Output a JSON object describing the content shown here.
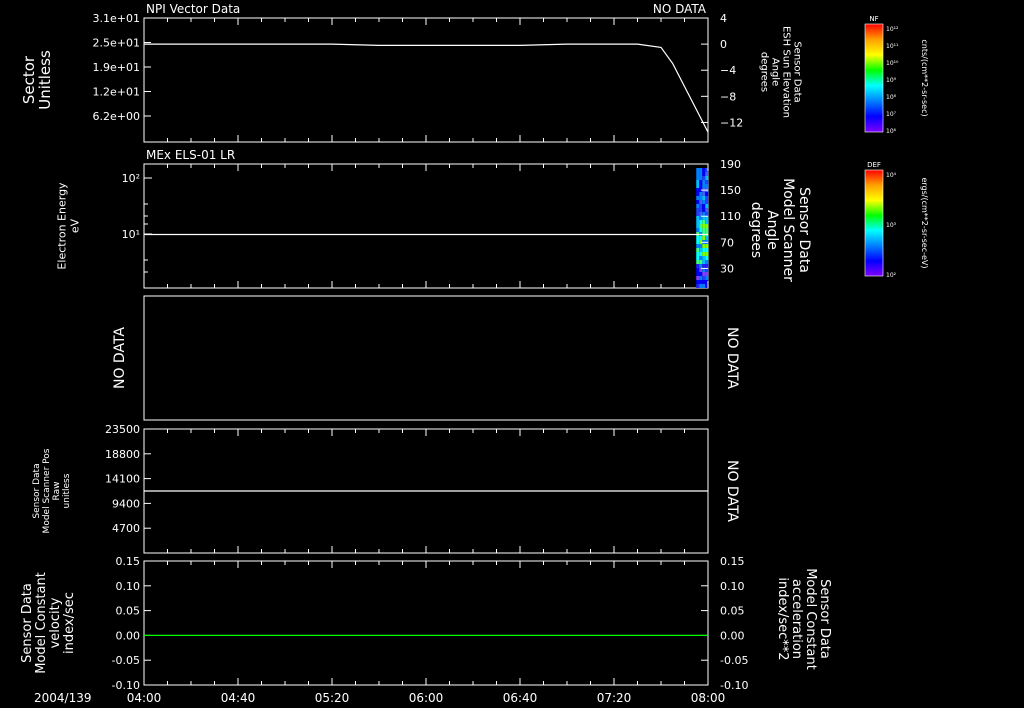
{
  "page": {
    "date": "2004/139",
    "x_tick_labels": [
      "04:00",
      "04:40",
      "05:20",
      "06:00",
      "06:40",
      "07:20",
      "08:00"
    ]
  },
  "colors": {
    "line": "#ffffff",
    "green": "#00ff00",
    "background": "#000000"
  },
  "colorbars": [
    {
      "title": "NF",
      "ticks": [
        "10¹²",
        "10¹¹",
        "10¹⁰",
        "10⁹",
        "10⁸",
        "10⁷",
        "10⁶"
      ],
      "label": "cnts/(cm**2-sr-sec)"
    },
    {
      "title": "DEF",
      "ticks": [
        "10⁴",
        "10³",
        "10²"
      ],
      "label": "ergs/(cm**2-sr-sec-eV)"
    }
  ],
  "chart_data": [
    {
      "type": "line",
      "title": "NPI Vector Data",
      "status": "NO DATA",
      "ylabel": "Sector\nUnitless",
      "y_tick_labels": [
        "3.1e+01",
        "2.5e+01",
        "1.9e+01",
        "1.2e+01",
        "6.2e+00"
      ],
      "ylim": [
        0,
        31
      ],
      "right_ylabel": "Sensor Data\nESH Sun Elevation\nAngle\ndegrees",
      "right_y_ticks": [
        4,
        0,
        -4,
        -8,
        -12
      ],
      "right_ylim": [
        -15,
        4
      ],
      "series": [
        {
          "x": [
            "04:00",
            "05:20",
            "05:40",
            "06:40",
            "07:00",
            "07:30",
            "07:40",
            "07:45",
            "07:50",
            "07:55",
            "08:00"
          ],
          "values": [
            0,
            0,
            -0.2,
            -0.2,
            0,
            0,
            -0.5,
            -3,
            -6.5,
            -10,
            -13.5
          ]
        }
      ]
    },
    {
      "type": "heatmap",
      "title": "MEx ELS-01 LR",
      "ylabel": "Electron Energy\neV",
      "y_tick_labels": [
        "10²",
        "10¹"
      ],
      "y_scale": "log",
      "right_ylabel": "Sensor Data\nModel Scanner\nAngle\ndegrees",
      "right_y_ticks": [
        190,
        150,
        110,
        70,
        30
      ],
      "right_ylim": [
        0,
        190
      ],
      "line_series": [
        {
          "x": [
            "04:00",
            "08:00"
          ],
          "values": [
            82,
            82
          ]
        }
      ],
      "data_span": [
        "07:55",
        "08:00"
      ]
    },
    {
      "type": "line",
      "ylabel": "NO DATA",
      "right_label": "NO DATA"
    },
    {
      "type": "line",
      "ylabel": "Sensor Data\nModel Scanner Pos\nRaw\nunitless",
      "y_tick_labels": [
        "23500",
        "18800",
        "14100",
        "9400",
        "4700"
      ],
      "ylim": [
        0,
        23500
      ],
      "right_label": "NO DATA",
      "series": [
        {
          "x": [
            "04:00",
            "08:00"
          ],
          "values": [
            11750,
            11750
          ]
        }
      ]
    },
    {
      "type": "line",
      "ylabel": "Sensor Data\nModel Constant\nvelocity\nindex/sec",
      "y_tick_labels": [
        "0.15",
        "0.10",
        "0.05",
        "0.00",
        "-0.05",
        "-0.10"
      ],
      "ylim": [
        -0.1,
        0.15
      ],
      "right_ylabel": "Sensor Data\nModel Constant\nacceleration\nindex/sec**2",
      "right_y_tick_labels": [
        "0.15",
        "0.10",
        "0.05",
        "0.00",
        "-0.05",
        "-0.10"
      ],
      "series": [
        {
          "x": [
            "04:00",
            "08:00"
          ],
          "values": [
            0,
            0
          ]
        }
      ]
    }
  ]
}
